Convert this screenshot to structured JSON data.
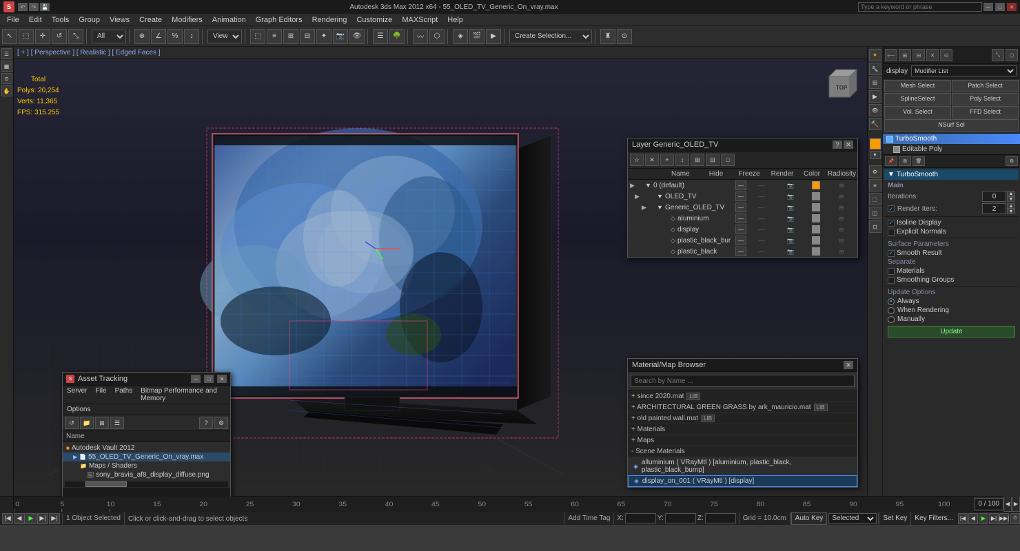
{
  "app": {
    "title": "Autodesk 3ds Max 2012 x64 - 55_OLED_TV_Generic_On_vray.max",
    "logo": "S"
  },
  "titlebar": {
    "minimize": "─",
    "maximize": "□",
    "close": "✕"
  },
  "menubar": {
    "items": [
      "File",
      "Edit",
      "Tools",
      "Group",
      "Views",
      "Create",
      "Modifiers",
      "Animation",
      "Graph Editors",
      "Rendering",
      "Customize",
      "MAXScript",
      "Help"
    ]
  },
  "toolbar": {
    "search_placeholder": "Type a keyword or phrase",
    "view_label": "View",
    "render_btn": "Render",
    "select_dropdown": "Create Selection..."
  },
  "viewport": {
    "header": "[ + ] [ Perspective ] [ Realistic ] [ Edged Faces ]",
    "stats": {
      "total_label": "Total",
      "poly_label": "Polys:",
      "poly_val": "20,254",
      "vert_label": "Verts:",
      "vert_val": "11,365",
      "fps_label": "FPS:",
      "fps_val": "315.255"
    }
  },
  "cmd_panel": {
    "display_label": "display",
    "modifier_list_label": "Modifier List",
    "buttons": {
      "mesh_select": "Mesh Select",
      "patch_select": "Patch Select",
      "spline_select": "SplineSelect",
      "poly_select": "Poly Select",
      "vol_select": "Vol. Select",
      "ffd_select": "FFD Select",
      "nsurf_sel": "NSurf Sel"
    },
    "modifier_stack": [
      {
        "name": "TurboSmooth",
        "selected": true,
        "color": "#4a8afa"
      },
      {
        "name": "Editable Poly",
        "selected": false,
        "color": "#888"
      }
    ],
    "turbo_smooth": {
      "section_label": "TurboSmooth",
      "main_label": "Main",
      "iterations_label": "Iterations:",
      "iterations_val": "0",
      "render_iters_label": "Render Iters:",
      "render_iters_val": "2",
      "isoline_label": "Isoline Display",
      "explicit_label": "Explicit Normals",
      "surface_label": "Surface Parameters",
      "smooth_label": "Smooth Result",
      "separate_label": "Separate",
      "materials_label": "Materials",
      "smoothing_label": "Smoothing Groups",
      "update_label": "Update Options",
      "always_label": "Always",
      "when_rendering_label": "When Rendering",
      "manually_label": "Manually",
      "update_btn": "Update"
    }
  },
  "layer_panel": {
    "title": "Layer Generic_OLED_TV",
    "toolbar_icons": [
      "☆",
      "✕",
      "+",
      "↕",
      "⊞",
      "⊟",
      "□"
    ],
    "columns": {
      "name": "Name",
      "hide": "Hide",
      "freeze": "Freeze",
      "render": "Render",
      "color": "Color",
      "radiosity": "Radiosity"
    },
    "layers": [
      {
        "name": "0 (default)",
        "indent": 0,
        "expand": true
      },
      {
        "name": "OLED_TV",
        "indent": 1,
        "expand": true
      },
      {
        "name": "Generic_OLED_TV",
        "indent": 2,
        "expand": true
      },
      {
        "name": "aluminium",
        "indent": 3
      },
      {
        "name": "display",
        "indent": 3
      },
      {
        "name": "plastic_black_bur",
        "indent": 3
      },
      {
        "name": "plastic_black",
        "indent": 3
      }
    ]
  },
  "asset_panel": {
    "title": "Asset Tracking",
    "menu": [
      "Server",
      "File",
      "Paths",
      "Bitmap Performance and Memory"
    ],
    "options": "Options",
    "col_header": "Name",
    "items": [
      {
        "name": "Autodesk Vault 2012",
        "indent": 0,
        "icon": "vault"
      },
      {
        "name": "55_OLED_TV_Generic_On_vray.max",
        "indent": 1,
        "icon": "file"
      },
      {
        "name": "Maps / Shaders",
        "indent": 2,
        "icon": "folder"
      },
      {
        "name": "sony_bravia_af8_display_diffuse.png",
        "indent": 3,
        "icon": "image"
      }
    ]
  },
  "mat_panel": {
    "title": "Material/Map Browser",
    "search_placeholder": "Search by Name ...",
    "sections": [
      {
        "name": "+ since 2020.mat",
        "badge": "LIB"
      },
      {
        "name": "+ ARCHITECTURAL GREEN GRASS by ark_mauricio.mat",
        "badge": "LIB"
      },
      {
        "name": "+ old painted wall.mat",
        "badge": "LIB"
      },
      {
        "name": "+ Materials",
        "badge": ""
      },
      {
        "name": "+ Maps",
        "badge": ""
      },
      {
        "name": "- Scene Materials",
        "badge": ""
      }
    ],
    "scene_materials": [
      {
        "name": "alluminium ( VRayMtl ) [aluminium, plastic_black, plastic_black_bump]",
        "selected": false
      },
      {
        "name": "display_on_001 ( VRayMtl ) [display]",
        "selected": true
      }
    ]
  },
  "timeline": {
    "current": "0 / 100",
    "frame_labels": [
      "0",
      "5",
      "10",
      "15",
      "20",
      "25",
      "30",
      "35",
      "40",
      "45",
      "50",
      "55",
      "60",
      "65",
      "70",
      "75",
      "80",
      "85",
      "90",
      "95",
      "100"
    ]
  },
  "statusbar": {
    "selected": "1 Object Selected",
    "instruction": "Click or click-and-drag to select objects",
    "grid": "Grid = 10.0cm",
    "auto_key": "Auto Key",
    "selected_mode": "Selected",
    "set_key": "Set Key",
    "key_filters": "Key Filters..."
  },
  "coord": {
    "x_label": "X:",
    "y_label": "Y:",
    "z_label": "Z:"
  }
}
